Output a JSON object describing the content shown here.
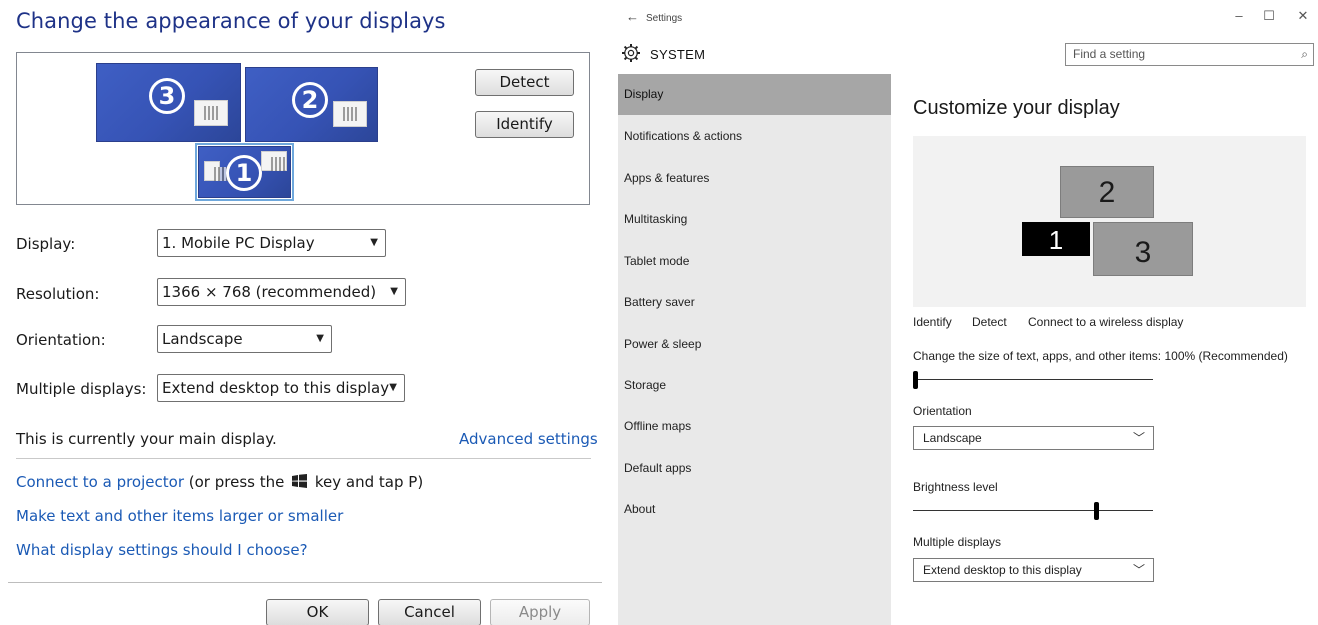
{
  "win7": {
    "title": "Change the appearance of your displays",
    "monitors": [
      "3",
      "2",
      "1"
    ],
    "detect_label": "Detect",
    "identify_label": "Identify",
    "display_label": "Display:",
    "display_value": "1. Mobile PC Display",
    "resolution_label": "Resolution:",
    "resolution_value": "1366 × 768 (recommended)",
    "orientation_label": "Orientation:",
    "orientation_value": "Landscape",
    "multiple_label": "Multiple displays:",
    "multiple_value": "Extend desktop to this display",
    "main_display_text": "This is currently your main display.",
    "advanced_link": "Advanced settings",
    "projector_link": "Connect to a projector",
    "projector_text_before": "(or press the",
    "projector_text_after": "key and tap P)",
    "text_size_link": "Make text and other items larger or smaller",
    "choose_link": "What display settings should I choose?",
    "ok_label": "OK",
    "cancel_label": "Cancel",
    "apply_label": "Apply"
  },
  "win10": {
    "window_title": "Settings",
    "section": "SYSTEM",
    "search_placeholder": "Find a setting",
    "nav": [
      {
        "label": "Display",
        "active": true
      },
      {
        "label": "Notifications & actions"
      },
      {
        "label": "Apps & features"
      },
      {
        "label": "Multitasking"
      },
      {
        "label": "Tablet mode"
      },
      {
        "label": "Battery saver"
      },
      {
        "label": "Power & sleep"
      },
      {
        "label": "Storage"
      },
      {
        "label": "Offline maps"
      },
      {
        "label": "Default apps"
      },
      {
        "label": "About"
      }
    ],
    "heading": "Customize your display",
    "monitors": [
      "2",
      "1",
      "3"
    ],
    "actions": [
      "Identify",
      "Detect",
      "Connect to a wireless display"
    ],
    "size_label": "Change the size of text, apps, and other items: 100% (Recommended)",
    "size_level": 0,
    "orientation_label": "Orientation",
    "orientation_value": "Landscape",
    "brightness_label": "Brightness level",
    "brightness_level": 0.77,
    "multiple_label": "Multiple displays",
    "multiple_value": "Extend desktop to this display"
  },
  "icons": {
    "back": "arrow-left-icon",
    "minimize": "minimize-icon",
    "maximize": "maximize-icon",
    "close": "close-icon",
    "gear": "gear-icon",
    "search": "search-icon",
    "chevron": "chevron-down-icon",
    "windows": "windows-logo-icon"
  },
  "colors": {
    "w7_title": "#1e3287",
    "w7_link": "#1b5ab5",
    "w7_monitor": "#3653b5",
    "w10_sidebar": "#e9e9e9",
    "w10_active_nav": "#a6a6a6",
    "w10_monitor": "#9a9a9a",
    "w10_active_monitor": "#000000"
  }
}
